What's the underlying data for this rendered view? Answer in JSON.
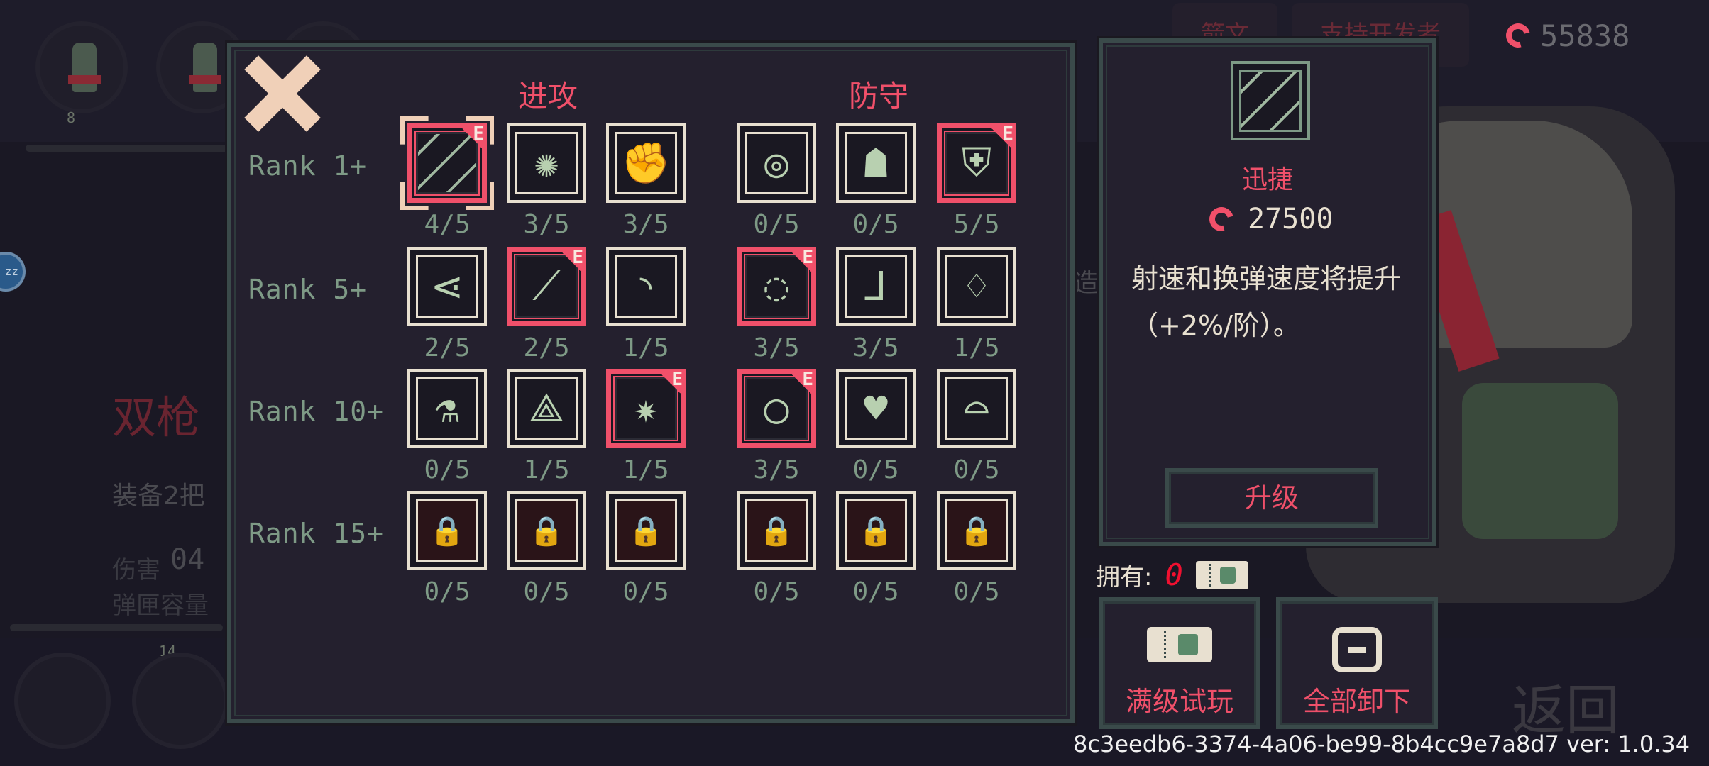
{
  "background": {
    "weapon_title": "双枪",
    "weapon_desc": "装备2把",
    "stat_damage_label": "伤害",
    "stat_damage_value": "04",
    "stat_mag_label": "弹匣容量",
    "top_btn_1": "箭文",
    "top_btn_2": "支持开发者",
    "currency_value": "55838",
    "return_label": "返回",
    "hero_level": "8",
    "weapon_level": "14",
    "edge_text": "造",
    "bubble_text": "zz"
  },
  "panel": {
    "close_icon": "close-icon",
    "col_attack": "进攻",
    "col_defense": "防守",
    "ranks": [
      {
        "label": "Rank 1+",
        "slots": [
          {
            "icon": "swiftness-icon",
            "level": "4/5",
            "equipped": true,
            "selected": true,
            "locked": false
          },
          {
            "icon": "vortex-icon",
            "level": "3/5",
            "equipped": false,
            "selected": false,
            "locked": false
          },
          {
            "icon": "fist-icon",
            "level": "3/5",
            "equipped": false,
            "selected": false,
            "locked": false
          },
          {
            "icon": "keyhole-icon",
            "level": "0/5",
            "equipped": false,
            "selected": false,
            "locked": false
          },
          {
            "icon": "flex-icon",
            "level": "0/5",
            "equipped": false,
            "selected": false,
            "locked": false
          },
          {
            "icon": "shield-icon",
            "level": "5/5",
            "equipped": true,
            "selected": false,
            "locked": false
          }
        ]
      },
      {
        "label": "Rank 5+",
        "slots": [
          {
            "icon": "spread-icon",
            "level": "2/5",
            "equipped": false,
            "selected": false,
            "locked": false
          },
          {
            "icon": "claw-icon",
            "level": "2/5",
            "equipped": true,
            "selected": false,
            "locked": false
          },
          {
            "icon": "wave-icon",
            "level": "1/5",
            "equipped": false,
            "selected": false,
            "locked": false
          },
          {
            "icon": "cycle-icon",
            "level": "3/5",
            "equipped": true,
            "selected": false,
            "locked": false
          },
          {
            "icon": "boot-icon",
            "level": "3/5",
            "equipped": false,
            "selected": false,
            "locked": false
          },
          {
            "icon": "leaf-icon",
            "level": "1/5",
            "equipped": false,
            "selected": false,
            "locked": false
          }
        ]
      },
      {
        "label": "Rank 10+",
        "slots": [
          {
            "icon": "potion-icon",
            "level": "0/5",
            "equipped": false,
            "selected": false,
            "locked": false
          },
          {
            "icon": "rune-icon",
            "level": "1/5",
            "equipped": false,
            "selected": false,
            "locked": false
          },
          {
            "icon": "burst-icon",
            "level": "1/5",
            "equipped": true,
            "selected": false,
            "locked": false
          },
          {
            "icon": "orb-icon",
            "level": "3/5",
            "equipped": true,
            "selected": false,
            "locked": false
          },
          {
            "icon": "hearts-icon",
            "level": "0/5",
            "equipped": false,
            "selected": false,
            "locked": false
          },
          {
            "icon": "dome-icon",
            "level": "0/5",
            "equipped": false,
            "selected": false,
            "locked": false
          }
        ]
      },
      {
        "label": "Rank 15+",
        "slots": [
          {
            "icon": "locked-blade-icon",
            "level": "0/5",
            "equipped": false,
            "selected": false,
            "locked": true
          },
          {
            "icon": "locked-beast-icon",
            "level": "0/5",
            "equipped": false,
            "selected": false,
            "locked": true
          },
          {
            "icon": "locked-sword-icon",
            "level": "0/5",
            "equipped": false,
            "selected": false,
            "locked": true
          },
          {
            "icon": "locked-heart-icon",
            "level": "0/5",
            "equipped": false,
            "selected": false,
            "locked": true
          },
          {
            "icon": "locked-guard-icon",
            "level": "0/5",
            "equipped": false,
            "selected": false,
            "locked": true
          },
          {
            "icon": "locked-cross-icon",
            "level": "0/5",
            "equipped": false,
            "selected": false,
            "locked": true
          }
        ]
      }
    ],
    "equipped_tag": "E"
  },
  "detail": {
    "icon": "swiftness-icon",
    "name": "迅捷",
    "cost": "27500",
    "description": "射速和换弹速度将提升（+2%/阶）。",
    "upgrade_label": "升级"
  },
  "owned": {
    "label": "拥有:",
    "count": "0"
  },
  "actions": {
    "trial_label": "满级试玩",
    "unequip_all_label": "全部卸下"
  },
  "footer": {
    "build_id": "8c3eedb6-3374-4a06-be99-8b4cc9e7a8d7 ver: 1.0.34"
  },
  "colors": {
    "accent": "#f0506a",
    "panel_bg": "#24202e",
    "border": "#3a4a4a",
    "rank_text": "#7e9a86"
  }
}
